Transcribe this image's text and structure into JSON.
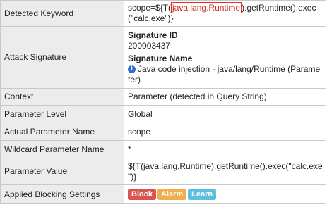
{
  "rows": {
    "detected_keyword": {
      "label": "Detected Keyword",
      "prefix": "scope=${T(",
      "keyword": "java.lang.Runtime",
      "suffix_line1": ").getRuntime().exec",
      "line2": "(\"calc.exe\")}"
    },
    "attack_signature": {
      "label": "Attack Signature",
      "id_heading": "Signature ID",
      "id_value": "200003437",
      "name_heading": "Signature Name",
      "name_line1": "Java code injection - java/lang/Runtime (Parame",
      "name_line2": "ter)"
    },
    "context": {
      "label": "Context",
      "value": "Parameter (detected in Query String)"
    },
    "parameter_level": {
      "label": "Parameter Level",
      "value": "Global"
    },
    "actual_parameter_name": {
      "label": "Actual Parameter Name",
      "value": "scope"
    },
    "wildcard_parameter_name": {
      "label": "Wildcard Parameter Name",
      "value": "*"
    },
    "parameter_value": {
      "label": "Parameter Value",
      "line1": "${T(java.lang.Runtime).getRuntime().exec(\"calc.exe",
      "line2": "\")}"
    },
    "applied_blocking_settings": {
      "label": "Applied Blocking Settings",
      "badges": [
        "Block",
        "Alarm",
        "Learn"
      ]
    }
  },
  "colors": {
    "block": "#d9534f",
    "alarm": "#f0ad4e",
    "learn": "#5bc0de",
    "keyword_highlight": "#e0302a",
    "label_bg": "#ececec"
  },
  "icons": {
    "signature_name": "info-icon"
  }
}
